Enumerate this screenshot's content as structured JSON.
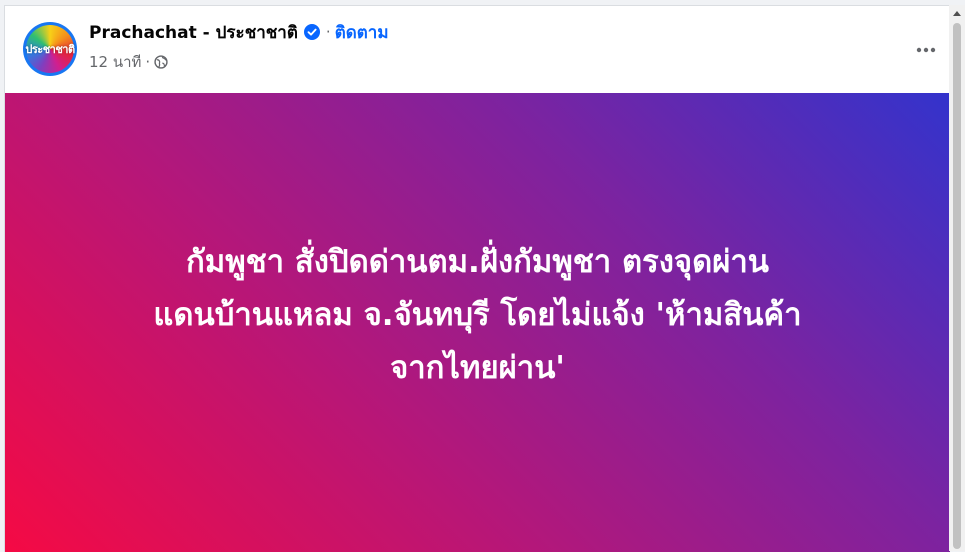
{
  "post": {
    "page_name": "Prachachat - ประชาชาติ",
    "avatar_text": "ประชาชาติ",
    "verified_icon": "verified-badge-icon",
    "separator": "·",
    "follow_label": "ติดตาม",
    "time": "12 นาที",
    "audience_icon": "globe-icon",
    "more_icon": "more-options-icon",
    "headline_lines": [
      "กัมพูชา สั่งปิดด่านตม.ฝั่งกัมพูชา ตรงจุดผ่าน",
      "แดนบ้านแหลม จ.จันทบุรี โดยไม่แจ้ง 'ห้ามสินค้า",
      "จากไทยผ่าน'"
    ]
  },
  "colors": {
    "brand_blue": "#0866ff",
    "gradient_start": "#f50a44",
    "gradient_end": "#3333cc"
  }
}
